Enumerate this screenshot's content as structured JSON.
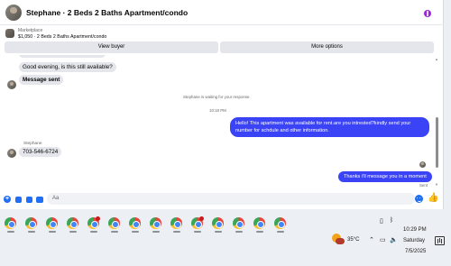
{
  "header": {
    "title": "Stephane · 2 Beds 2 Baths Apartment/condo"
  },
  "listing": {
    "source": "Marketplace",
    "info": "$1,050 · 2 Beds 2 Baths Apartment/condo"
  },
  "actions": {
    "view_buyer": "View buyer",
    "more_options": "More options"
  },
  "messages": {
    "in_1": "Good evening, is this still available?",
    "in_2": "Message sent",
    "waiting": "Stephane is waiting for your response.",
    "time_1": "10:18 PM",
    "out_1": "Hello! This apartment was available for rent.are you intrested?kindly send your number for schdule and other information.",
    "sender_name": "Stephane",
    "in_3": "703-546-6724",
    "out_2": "Thanks i'll message you in a moment",
    "status": "Sent"
  },
  "composer": {
    "placeholder": "Aa"
  },
  "taskbar": {
    "temperature": "35°C",
    "time": "10:29 PM",
    "day": "Saturday",
    "date": "7/5/2025",
    "app_icon": "chrome-icon",
    "app_count": 14
  },
  "colors": {
    "accent": "#1f6ef5",
    "outgoing_bubble": "#3a43f5",
    "menu_dot": "#9b27d8"
  }
}
